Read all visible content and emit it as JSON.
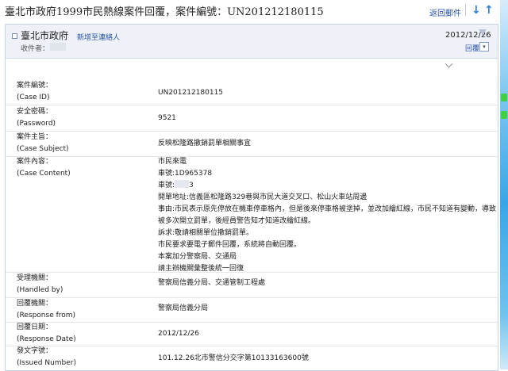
{
  "toolbar": {
    "subject": "臺北市政府1999市民熱線案件回覆，案件編號：UN201212180115",
    "back_label": "返回郵件",
    "down_icon": "arrow-down-icon",
    "up_icon": "arrow-up-icon"
  },
  "header": {
    "sender": "臺北市政府",
    "add_contact": "新增至連絡人",
    "recipient_label": "收件者：",
    "date": "2012/12/26",
    "reply_label": "回覆"
  },
  "fields": [
    {
      "label_zh": "案件編號：",
      "label_en": "(Case ID)",
      "value": "UN201212180115"
    },
    {
      "label_zh": "安全密碼：",
      "label_en": "(Password)",
      "value": "9521"
    },
    {
      "label_zh": "案件主旨：",
      "label_en": "(Case Subject)",
      "value": "反映松隆路撤銷罰單相關事宜"
    }
  ],
  "content": {
    "label_zh": "案件內容：",
    "label_en": "(Case Content)",
    "lines": [
      "市民來電",
      "車號:1D965378",
      "車號:",
      "開單地址:信義區松隆路329巷與市民大道交叉口、松山火車站周邊",
      "事由:市民表示原先停放在機車停車格內，但是後來停車格被塗掉，並改加繪紅線，市民不知道有變動，導致",
      "被多次開立罰單，後經員警告知才知道改繪紅線。",
      "訴求:敬請相關單位撤銷罰單。",
      "市民要求要電子郵件回覆，系統將自動回覆。",
      "本案加分警察局、交通局",
      "請主辦機關彙整後統一回復"
    ],
    "line3_suffix": "3"
  },
  "details": [
    {
      "label_zh": "受理機關：",
      "label_en": "(Handled by)",
      "value": "警察局信義分局、交通管制工程處"
    },
    {
      "label_zh": "回覆機關：",
      "label_en": "(Response from)",
      "value": "警察局信義分局"
    },
    {
      "label_zh": "回覆日期：",
      "label_en": "(Response Date)",
      "value": "2012/12/26"
    },
    {
      "label_zh": "發文字號：",
      "label_en": "(Issued Number)",
      "value": "101.12.26北市警信分交字第10133163600號"
    }
  ],
  "colors": {
    "link": "#2a55a8",
    "header_bg": "#eef2f8",
    "arrow": "#2b7be0"
  }
}
